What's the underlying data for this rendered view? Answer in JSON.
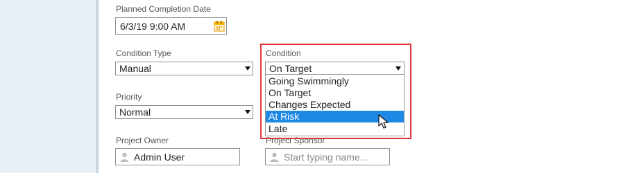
{
  "planned_completion": {
    "label": "Planned Completion Date",
    "value": "6/3/19 9:00 AM",
    "icon": "calendar-icon"
  },
  "condition_type": {
    "label": "Condition Type",
    "value": "Manual"
  },
  "condition": {
    "label": "Condition",
    "value": "On Target",
    "options": [
      {
        "label": "Going Swimmingly"
      },
      {
        "label": "On Target"
      },
      {
        "label": "Changes Expected"
      },
      {
        "label": "At Risk",
        "highlighted": true
      },
      {
        "label": "Late"
      }
    ],
    "highlight_color": "#e0383a",
    "selected_color": "#1e88e5"
  },
  "priority": {
    "label": "Priority",
    "value": "Normal"
  },
  "project_owner": {
    "label": "Project Owner",
    "value": "Admin User",
    "icon": "person-icon"
  },
  "project_sponsor": {
    "label": "Project Sponsor",
    "placeholder": "Start typing name...",
    "icon": "person-icon"
  }
}
